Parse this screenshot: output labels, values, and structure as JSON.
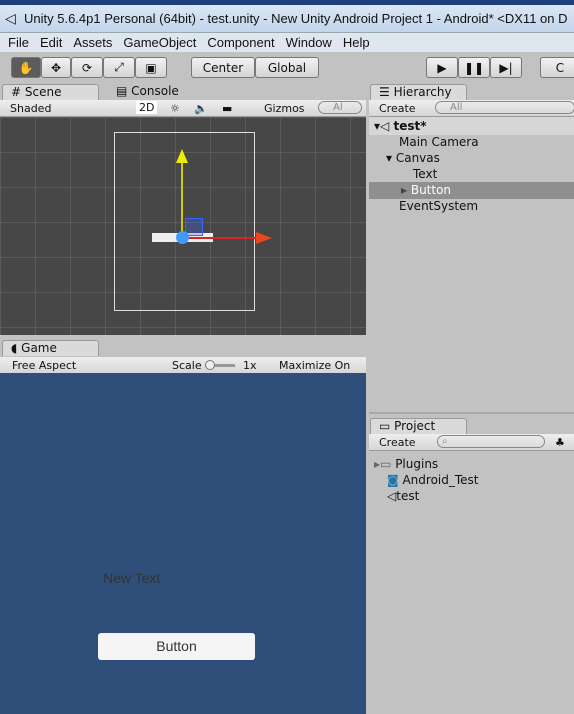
{
  "window": {
    "title": "Unity 5.6.4p1 Personal (64bit) - test.unity - New Unity Android Project 1 - Android* <DX11 on D"
  },
  "menu": [
    "File",
    "Edit",
    "Assets",
    "GameObject",
    "Component",
    "Window",
    "Help"
  ],
  "toolbar": {
    "tools": [
      "hand-icon",
      "move-icon",
      "rotate-icon",
      "scale-icon",
      "rect-icon"
    ],
    "center": "Center",
    "global": "Global",
    "collab": "C"
  },
  "scene": {
    "tab": "Scene",
    "console_tab": "Console",
    "shading": "Shaded",
    "mode_2d": "2D",
    "gizmos": "Gizmos",
    "search_placeholder": "Al"
  },
  "game": {
    "tab": "Game",
    "aspect": "Free Aspect",
    "scale_label": "Scale",
    "scale_value": "1x",
    "maximize": "Maximize On Pla",
    "text": "New Text",
    "button": "Button",
    "bg_color": "#2f4e79"
  },
  "hierarchy": {
    "tab": "Hierarchy",
    "create": "Create",
    "search_placeholder": "All",
    "scene": "test*",
    "items": [
      "Main Camera",
      "Canvas",
      "Text",
      "Button",
      "EventSystem"
    ],
    "selected": "Button"
  },
  "project": {
    "tab": "Project",
    "create": "Create",
    "items": [
      "Plugins",
      "Android_Test",
      "test"
    ]
  }
}
